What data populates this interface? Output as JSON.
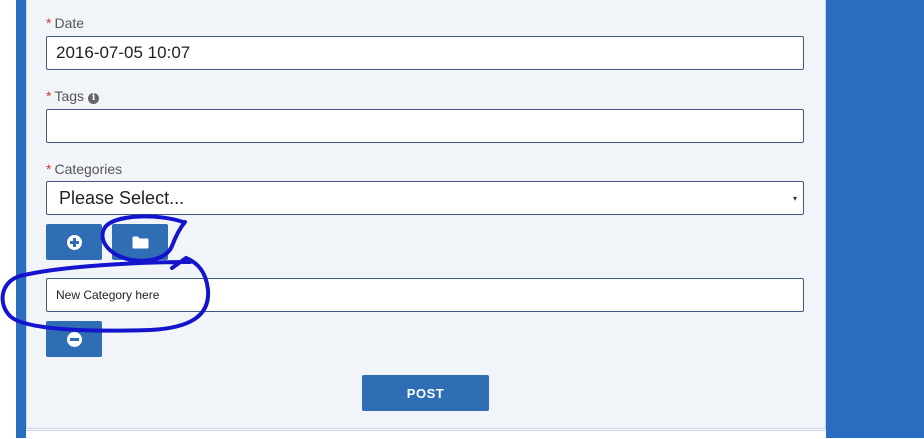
{
  "form": {
    "date": {
      "label": "Date",
      "required_mark": "*",
      "value": "2016-07-05 10:07"
    },
    "tags": {
      "label": "Tags",
      "required_mark": "*",
      "info_icon": "i",
      "value": ""
    },
    "categories": {
      "label": "Categories",
      "required_mark": "*",
      "selected": "Please Select...",
      "caret": "▾"
    },
    "new_category": {
      "value": "New Category here"
    },
    "buttons": {
      "add_icon": "plus-circle-icon",
      "folder_icon": "folder-icon",
      "remove_icon": "minus-circle-icon",
      "post_label": "POST"
    }
  },
  "colors": {
    "accent": "#2f6db5",
    "side_panel": "#2a6cbf",
    "card_bg": "#f1f5fa",
    "required": "#d9342b",
    "annotation": "#1414cc"
  }
}
